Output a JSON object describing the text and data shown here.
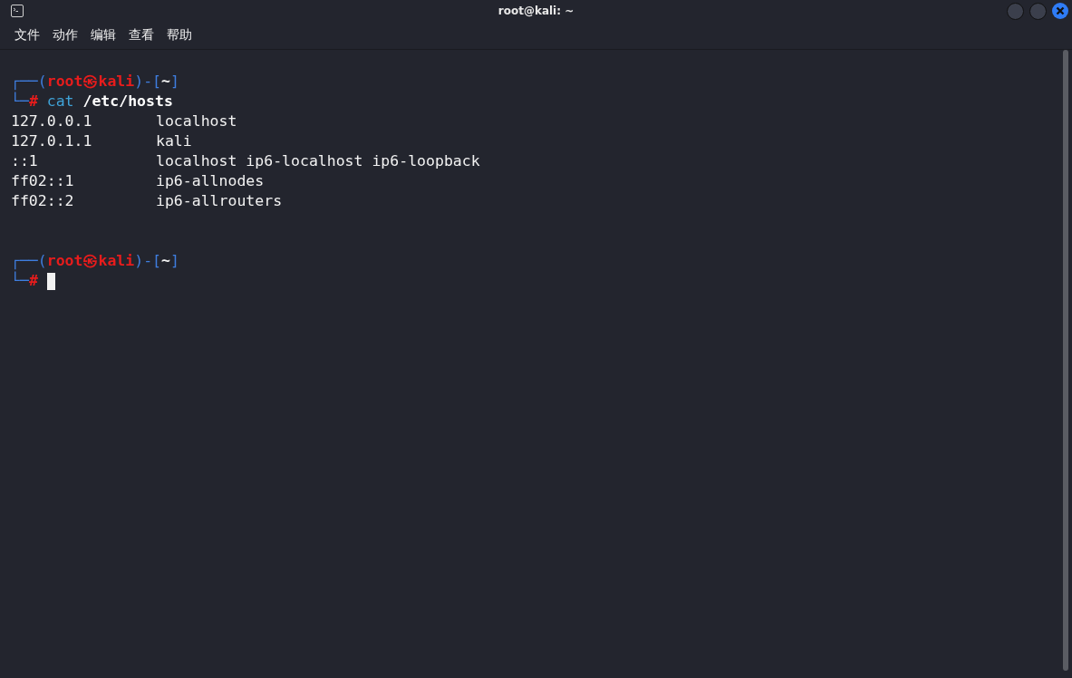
{
  "window": {
    "title": "root@kali: ~"
  },
  "menu": [
    {
      "label": "文件"
    },
    {
      "label": "动作"
    },
    {
      "label": "编辑"
    },
    {
      "label": "查看"
    },
    {
      "label": "帮助"
    }
  ],
  "terminal": {
    "lines": [
      {
        "kind": "blank"
      },
      {
        "kind": "segments",
        "segments": [
          {
            "kind": "frame",
            "text": "┌──("
          },
          {
            "kind": "user",
            "text": "root㉿kali"
          },
          {
            "kind": "frame",
            "text": ")-["
          },
          {
            "kind": "path",
            "text": "~"
          },
          {
            "kind": "frame",
            "text": "]"
          }
        ]
      },
      {
        "kind": "segments",
        "segments": [
          {
            "kind": "frame",
            "text": "└─"
          },
          {
            "kind": "hash",
            "text": "#"
          },
          {
            "kind": "command",
            "text": " cat"
          },
          {
            "kind": "arg",
            "text": " /etc/hosts"
          }
        ]
      },
      {
        "kind": "columns",
        "cells": [
          "127.0.0.1",
          "localhost"
        ]
      },
      {
        "kind": "columns",
        "cells": [
          "127.0.1.1",
          "kali"
        ]
      },
      {
        "kind": "columns",
        "cells": [
          "::1",
          "localhost ip6-localhost ip6-loopback"
        ]
      },
      {
        "kind": "columns",
        "cells": [
          "ff02::1",
          "ip6-allnodes"
        ]
      },
      {
        "kind": "columns",
        "cells": [
          "ff02::2",
          "ip6-allrouters"
        ]
      },
      {
        "kind": "blank"
      },
      {
        "kind": "blank"
      },
      {
        "kind": "segments",
        "segments": [
          {
            "kind": "frame",
            "text": "┌──("
          },
          {
            "kind": "user",
            "text": "root㉿kali"
          },
          {
            "kind": "frame",
            "text": ")-["
          },
          {
            "kind": "path",
            "text": "~"
          },
          {
            "kind": "frame",
            "text": "]"
          }
        ]
      },
      {
        "kind": "segments",
        "segments": [
          {
            "kind": "frame",
            "text": "└─"
          },
          {
            "kind": "hash",
            "text": "#"
          },
          {
            "kind": "cursor"
          }
        ]
      }
    ]
  }
}
